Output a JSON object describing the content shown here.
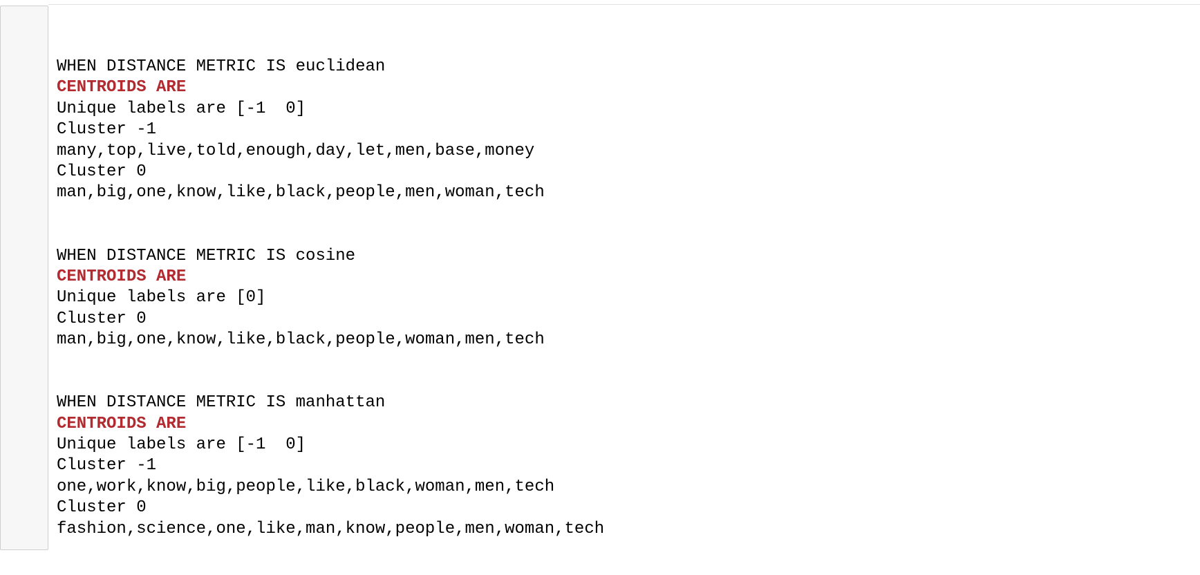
{
  "colors": {
    "heading_red": "#b22b31",
    "text": "#000000",
    "gutter_bg": "#f7f7f7",
    "gutter_border": "#cfcfcf"
  },
  "blocks": [
    {
      "metric_line": "WHEN DISTANCE METRIC IS euclidean",
      "centroids_label": "CENTROIDS ARE",
      "unique_labels": "Unique labels are [-1  0]",
      "clusters": [
        {
          "header": "Cluster -1",
          "words": "many,top,live,told,enough,day,let,men,base,money"
        },
        {
          "header": "Cluster 0",
          "words": "man,big,one,know,like,black,people,men,woman,tech"
        }
      ]
    },
    {
      "metric_line": "WHEN DISTANCE METRIC IS cosine",
      "centroids_label": "CENTROIDS ARE",
      "unique_labels": "Unique labels are [0]",
      "clusters": [
        {
          "header": "Cluster 0",
          "words": "man,big,one,know,like,black,people,woman,men,tech"
        }
      ]
    },
    {
      "metric_line": "WHEN DISTANCE METRIC IS manhattan",
      "centroids_label": "CENTROIDS ARE",
      "unique_labels": "Unique labels are [-1  0]",
      "clusters": [
        {
          "header": "Cluster -1",
          "words": "one,work,know,big,people,like,black,woman,men,tech"
        },
        {
          "header": "Cluster 0",
          "words": "fashion,science,one,like,man,know,people,men,woman,tech"
        }
      ]
    }
  ]
}
